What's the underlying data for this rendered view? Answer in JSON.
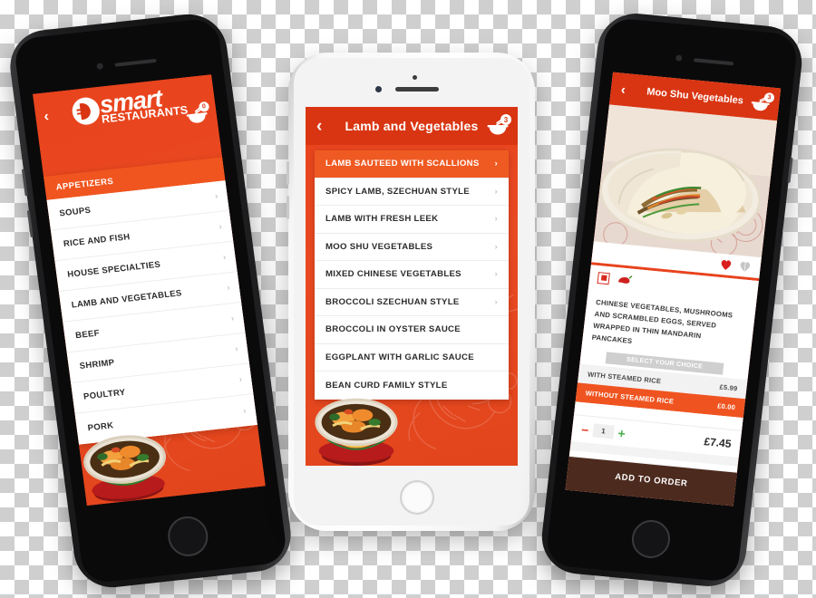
{
  "app": {
    "brand": {
      "name_part1": "smart",
      "name_part2": "RESTAURANTS",
      "logo_icon": "bowl-fork-logo-icon"
    },
    "accent_orange": "#e8431d",
    "accent_dark_orange": "#d93512",
    "highlight_orange": "#ef5a22",
    "order_button_brown": "#4c2a1e"
  },
  "phone1": {
    "frame_color": "black",
    "back_icon": "chevron-left-icon",
    "cart": {
      "icon": "bowl-chopsticks-cart-icon",
      "badge": "0"
    },
    "section_header": "APPETIZERS",
    "menu_items": [
      {
        "label": "SOUPS",
        "chevron": "›"
      },
      {
        "label": "RICE AND FISH",
        "chevron": "›"
      },
      {
        "label": "HOUSE SPECIALTIES",
        "chevron": "›"
      },
      {
        "label": "LAMB AND VEGETABLES",
        "chevron": "›"
      },
      {
        "label": "BEEF",
        "chevron": "›"
      },
      {
        "label": "SHRIMP",
        "chevron": "›"
      },
      {
        "label": "POULTRY",
        "chevron": "›"
      },
      {
        "label": "PORK",
        "chevron": "›"
      }
    ],
    "food_photo": "noodle-bowl-photo"
  },
  "phone2": {
    "frame_color": "white",
    "back_icon": "chevron-left-icon",
    "title": "Lamb and Vegetables",
    "cart": {
      "icon": "bowl-chopsticks-cart-icon",
      "badge": "3"
    },
    "dishes": [
      {
        "label": "LAMB SAUTEED WITH SCALLIONS",
        "selected": true,
        "chevron": "›"
      },
      {
        "label": "SPICY LAMB, SZECHUAN STYLE",
        "selected": false,
        "chevron": "›"
      },
      {
        "label": "LAMB WITH FRESH LEEK",
        "selected": false,
        "chevron": "›"
      },
      {
        "label": "MOO SHU VEGETABLES",
        "selected": false,
        "chevron": "›"
      },
      {
        "label": "MIXED CHINESE VEGETABLES",
        "selected": false,
        "chevron": "›"
      },
      {
        "label": "BROCCOLI SZECHUAN STYLE",
        "selected": false,
        "chevron": "›"
      },
      {
        "label": "BROCCOLI IN OYSTER SAUCE",
        "selected": false,
        "chevron": ""
      },
      {
        "label": "EGGPLANT WITH GARLIC SAUCE",
        "selected": false,
        "chevron": ""
      },
      {
        "label": "BEAN CURD FAMILY STYLE",
        "selected": false,
        "chevron": ""
      }
    ],
    "food_photo": "noodle-bowl-photo"
  },
  "phone3": {
    "frame_color": "black",
    "back_icon": "chevron-left-icon",
    "title": "Moo Shu Vegetables",
    "cart": {
      "icon": "bowl-chopsticks-cart-icon",
      "badge": "3"
    },
    "dish_photo": "moo-shu-pancakes-photo",
    "favorite_icon": "heart-filled-icon",
    "share_icon": "heart-outline-icon",
    "tags": {
      "vegetarian_icon": "vegetarian-badge-icon",
      "spicy_icon": "chili-pepper-icon"
    },
    "description": "CHINESE VEGETABLES, MUSHROOMS AND SCRAMBLED EGGS, SERVED WRAPPED IN THIN MANDARIN PANCAKES",
    "choice_header": "SELECT YOUR CHOICE",
    "options": [
      {
        "label": "WITH STEAMED RICE",
        "price": "£5.99",
        "selected": false
      },
      {
        "label": "WITHOUT STEAMED RICE",
        "price": "£0.00",
        "selected": true
      }
    ],
    "quantity": {
      "minus": "−",
      "value": "1",
      "plus": "+"
    },
    "total_price": "£7.45",
    "add_button": "ADD TO ORDER"
  }
}
